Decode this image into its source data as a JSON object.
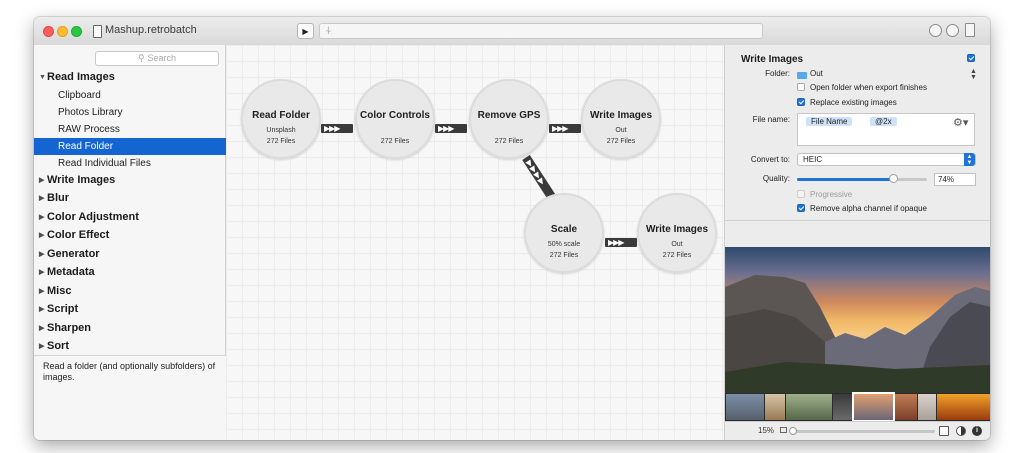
{
  "window": {
    "title": "Mashup.retrobatch"
  },
  "toolbar": {
    "play_glyph": "▶",
    "status_glyph": "⍭"
  },
  "sidebar": {
    "search_placeholder": "Search",
    "groups": [
      {
        "label": "Read Images",
        "expanded": true
      },
      {
        "label": "Write Images"
      },
      {
        "label": "Blur"
      },
      {
        "label": "Color Adjustment"
      },
      {
        "label": "Color Effect"
      },
      {
        "label": "Generator"
      },
      {
        "label": "Metadata"
      },
      {
        "label": "Misc"
      },
      {
        "label": "Script"
      },
      {
        "label": "Sharpen"
      },
      {
        "label": "Sort"
      }
    ],
    "read_images_items": [
      "Clipboard",
      "Photos Library",
      "RAW Process",
      "Read Folder",
      "Read Individual Files"
    ],
    "selected_item": "Read Folder",
    "description": "Read a folder (and optionally subfolders) of images."
  },
  "nodes": [
    {
      "title": "Read Folder",
      "sub": "Unsplash",
      "files": "272 Files"
    },
    {
      "title": "Color Controls",
      "sub": "",
      "files": "272 Files"
    },
    {
      "title": "Remove GPS",
      "sub": "",
      "files": "272 Files"
    },
    {
      "title": "Write Images",
      "sub": "Out",
      "files": "272 Files"
    },
    {
      "title": "Scale",
      "sub": "50% scale",
      "files": "272 Files"
    },
    {
      "title": "Write Images",
      "sub": "Out",
      "files": "272 Files"
    }
  ],
  "inspector": {
    "title": "Write Images",
    "enabled": true,
    "folder_label": "Folder:",
    "folder_value": "Out",
    "open_folder_label": "Open folder when export finishes",
    "open_folder_checked": false,
    "replace_label": "Replace existing images",
    "replace_checked": true,
    "filename_label": "File name:",
    "filename_tokens": [
      "File Name",
      "@2x"
    ],
    "convert_label": "Convert to:",
    "convert_value": "HEIC",
    "quality_label": "Quality:",
    "quality_value": "74%",
    "quality_fraction": 0.74,
    "progressive_label": "Progressive",
    "progressive_checked": false,
    "remove_alpha_label": "Remove alpha channel if opaque",
    "remove_alpha_checked": true
  },
  "preview": {
    "zoom_text": "15%",
    "zoom_fraction": 0.0
  },
  "colors": {
    "accent": "#1f73d8",
    "selection": "#1464d2",
    "connector": "#3a3a3a",
    "node_fill": "#e9e9e9"
  }
}
